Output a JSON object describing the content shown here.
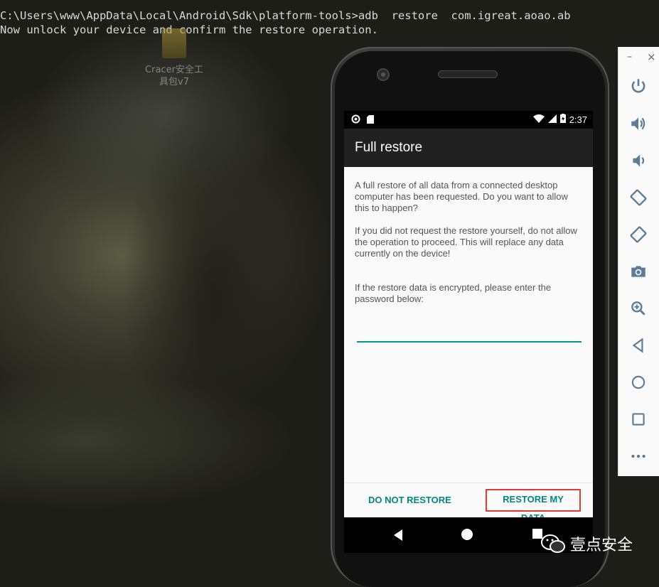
{
  "terminal": {
    "line1": "C:\\Users\\www\\AppData\\Local\\Android\\Sdk\\platform-tools>adb  restore  com.igreat.aoao.ab",
    "line2": "Now unlock your device and confirm the restore operation."
  },
  "desktop_icon": {
    "label_line1": "Cracer安全工",
    "label_line2": "具包v7"
  },
  "status_bar": {
    "time": "2:37"
  },
  "dialog": {
    "title": "Full restore",
    "paragraph1": "A full restore of all data from a connected desktop computer has been requested. Do you want to allow this to happen?",
    "paragraph2": "If you did not request the restore yourself, do not allow the operation to proceed. This will replace any data currently on the device!",
    "paragraph3": "If the restore data is encrypted, please enter the password below:",
    "password_value": "",
    "deny_button": "DO NOT RESTORE",
    "confirm_button": "RESTORE MY DATA"
  },
  "toolbar": {
    "minimize": "–",
    "close": "×",
    "buttons": [
      "power-icon",
      "volume-up-icon",
      "volume-down-icon",
      "rotate-left-icon",
      "rotate-right-icon",
      "camera-icon",
      "zoom-icon",
      "back-icon",
      "home-icon",
      "overview-icon",
      "more-icon"
    ]
  },
  "watermark": {
    "text": "壹点安全"
  },
  "colors": {
    "accent": "#009688",
    "highlight_box": "#e53935",
    "toolbar_icon": "#5c7d99"
  }
}
